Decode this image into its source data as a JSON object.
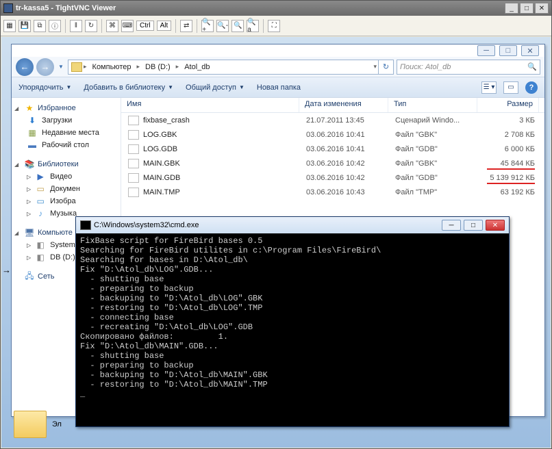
{
  "vnc": {
    "title": "tr-kassa5 - TightVNC Viewer",
    "toolbar_keys": {
      "ctrl": "Ctrl",
      "alt": "Alt"
    }
  },
  "explorer": {
    "breadcrumb": [
      "Компьютер",
      "DB (D:)",
      "Atol_db"
    ],
    "search_placeholder": "Поиск: Atol_db",
    "commands": {
      "organize": "Упорядочить",
      "add_library": "Добавить в библиотеку",
      "share": "Общий доступ",
      "new_folder": "Новая папка"
    },
    "columns": {
      "name": "Имя",
      "date": "Дата изменения",
      "type": "Тип",
      "size": "Размер"
    },
    "sidebar": {
      "favorites": {
        "label": "Избранное",
        "items": [
          {
            "label": "Загрузки",
            "ico": "ic-down"
          },
          {
            "label": "Недавние места",
            "ico": "ic-clock"
          },
          {
            "label": "Рабочий стол",
            "ico": "ic-desk"
          }
        ]
      },
      "libraries": {
        "label": "Библиотеки",
        "items": [
          {
            "label": "Видео",
            "ico": "ic-vid"
          },
          {
            "label": "Докумен",
            "ico": "ic-doc"
          },
          {
            "label": "Изобра",
            "ico": "ic-img"
          },
          {
            "label": "Музыка",
            "ico": "ic-mus"
          }
        ]
      },
      "computer": {
        "label": "Компьюте",
        "items": [
          {
            "label": "System (",
            "ico": "ic-drv"
          },
          {
            "label": "DB (D:)",
            "ico": "ic-drv"
          }
        ]
      },
      "network": {
        "label": "Сеть"
      }
    },
    "files": [
      {
        "name": "fixbase_crash",
        "date": "21.07.2011 13:45",
        "type": "Сценарий Windo...",
        "size": "3 КБ"
      },
      {
        "name": "LOG.GBK",
        "date": "03.06.2016 10:41",
        "type": "Файл \"GBK\"",
        "size": "2 708 КБ"
      },
      {
        "name": "LOG.GDB",
        "date": "03.06.2016 10:41",
        "type": "Файл \"GDB\"",
        "size": "6 000 КБ"
      },
      {
        "name": "MAIN.GBK",
        "date": "03.06.2016 10:42",
        "type": "Файл \"GBK\"",
        "size": "45 844 КБ"
      },
      {
        "name": "MAIN.GDB",
        "date": "03.06.2016 10:42",
        "type": "Файл \"GDB\"",
        "size": "5 139 912 КБ"
      },
      {
        "name": "MAIN.TMP",
        "date": "03.06.2016 10:43",
        "type": "Файл \"TMP\"",
        "size": "63 192 КБ"
      }
    ],
    "big_item_label": "Эл"
  },
  "cmd": {
    "title": "C:\\Windows\\system32\\cmd.exe",
    "lines": "FixBase script for FireBird bases 0.5\nSearching for FireBird utilites in c:\\Program Files\\FireBird\\\nSearching for bases in D:\\Atol_db\\\nFix \"D:\\Atol_db\\LOG\".GDB...\n  - shutting base\n  - preparing to backup\n  - backuping to \"D:\\Atol_db\\LOG\".GBK\n  - restoring to \"D:\\Atol_db\\LOG\".TMP\n  - connecting base\n  - recreating \"D:\\Atol_db\\LOG\".GDB\nСкопировано файлов:         1.\nFix \"D:\\Atol_db\\MAIN\".GDB...\n  - shutting base\n  - preparing to backup\n  - backuping to \"D:\\Atol_db\\MAIN\".GBK\n  - restoring to \"D:\\Atol_db\\MAIN\".TMP\n_"
  }
}
